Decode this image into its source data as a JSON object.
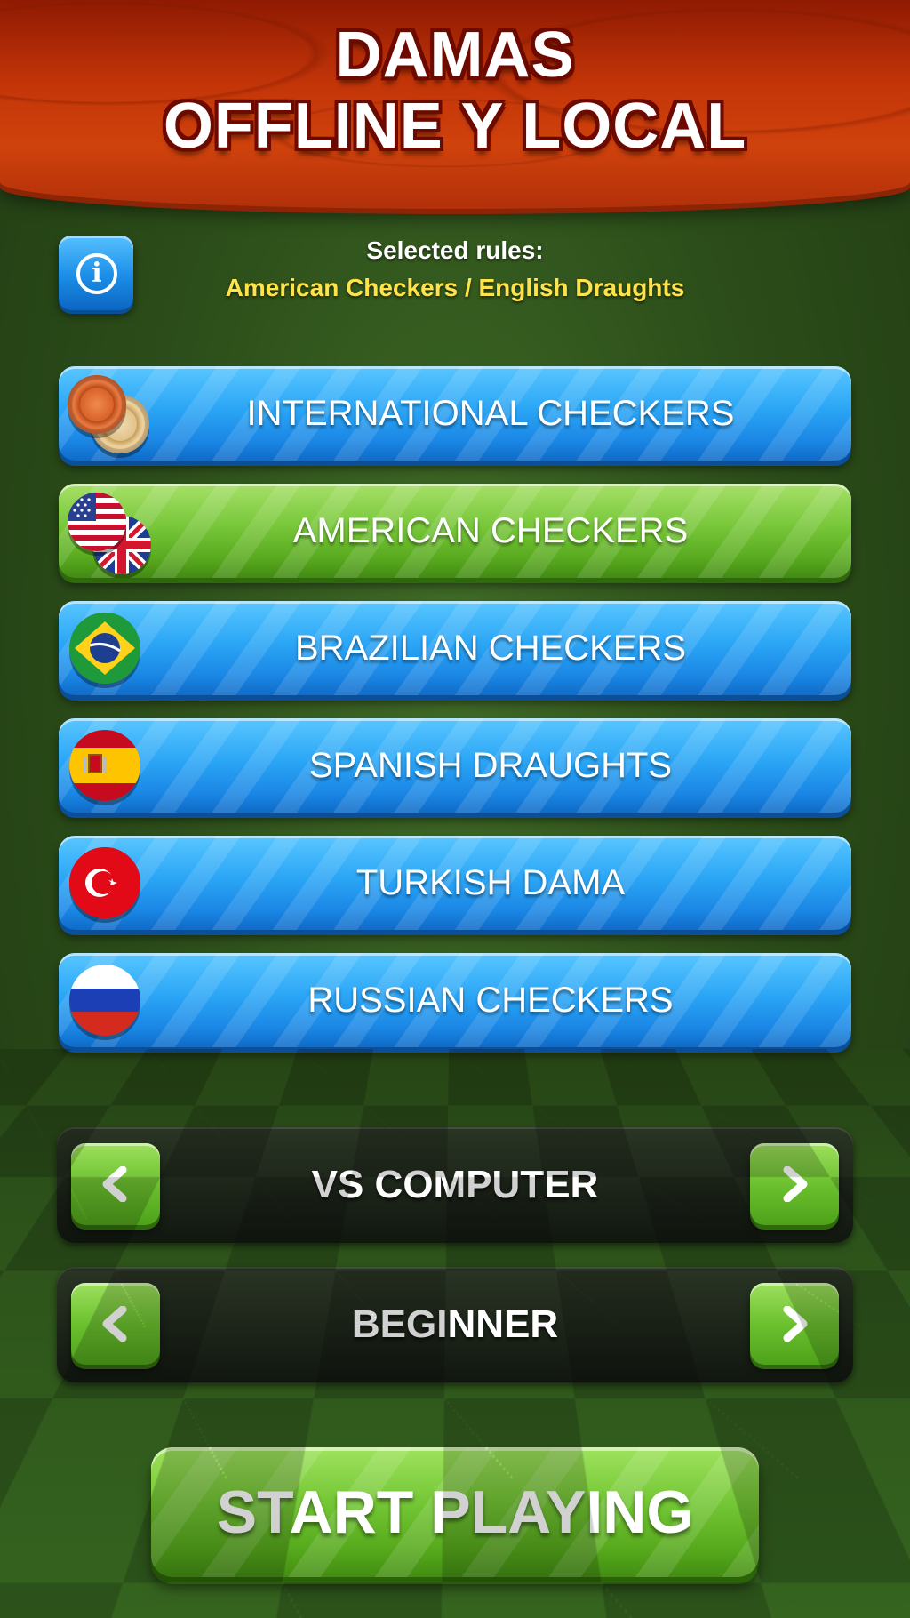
{
  "header": {
    "title_line1": "DAMAS",
    "title_line2": "OFFLINE Y LOCAL"
  },
  "rules": {
    "label": "Selected rules:",
    "value": "American Checkers / English Draughts"
  },
  "variants": [
    {
      "label": "INTERNATIONAL CHECKERS",
      "icon": "wooden-pieces-icon",
      "selected": false
    },
    {
      "label": "AMERICAN CHECKERS",
      "icon": "usa-uk-flags-icon",
      "selected": true
    },
    {
      "label": "BRAZILIAN CHECKERS",
      "icon": "brazil-flag-icon",
      "selected": false
    },
    {
      "label": "SPANISH DRAUGHTS",
      "icon": "spain-flag-icon",
      "selected": false
    },
    {
      "label": "TURKISH DAMA",
      "icon": "turkey-flag-icon",
      "selected": false
    },
    {
      "label": "RUSSIAN CHECKERS",
      "icon": "russia-flag-icon",
      "selected": false
    }
  ],
  "mode": {
    "value": "VS COMPUTER"
  },
  "difficulty": {
    "value": "BEGINNER"
  },
  "start": {
    "label": "START PLAYING"
  },
  "colors": {
    "header": "#c33508",
    "variant_blue": "#2ba6f6",
    "variant_selected_green": "#78c73a",
    "rules_value_yellow": "#ffe34a",
    "start_green": "#72c533"
  }
}
